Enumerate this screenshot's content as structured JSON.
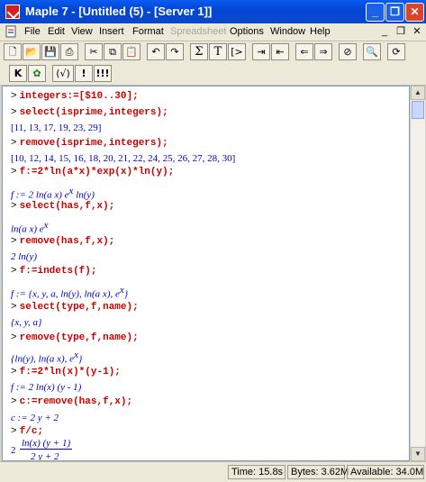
{
  "window": {
    "title": "Maple 7 - [Untitled (5) - [Server 1]]"
  },
  "menu": {
    "items": [
      {
        "label": "File"
      },
      {
        "label": "Edit"
      },
      {
        "label": "View"
      },
      {
        "label": "Insert"
      },
      {
        "label": "Format"
      },
      {
        "label": "Spreadsheet",
        "disabled": true
      },
      {
        "label": "Options"
      },
      {
        "label": "Window"
      },
      {
        "label": "Help"
      }
    ]
  },
  "toolbar2": {
    "k_label": "K",
    "paren_label": "(√)",
    "bang_label": "!",
    "bangs_label": "!!!"
  },
  "worksheet": {
    "lines": [
      {
        "type": "input",
        "prompt": ">",
        "text": "integers:=[$10..30];"
      },
      {
        "type": "input",
        "prompt": ">",
        "text": "select(isprime,integers);"
      },
      {
        "type": "output",
        "text": "[11, 13, 17, 19, 23, 29]"
      },
      {
        "type": "input",
        "prompt": ">",
        "text": "remove(isprime,integers);"
      },
      {
        "type": "output",
        "text": "[10, 12, 14, 15, 16, 18, 20, 21, 22, 24, 25, 26, 27, 28, 30]"
      },
      {
        "type": "input",
        "prompt": ">",
        "text": "f:=2*ln(a*x)*exp(x)*ln(y);"
      },
      {
        "type": "output",
        "text": "f := 2 ln(a x) e",
        "sup": "x",
        "tail": " ln(y)"
      },
      {
        "type": "input",
        "prompt": ">",
        "text": "select(has,f,x);"
      },
      {
        "type": "output",
        "text": "ln(a x) e",
        "sup": "x",
        "tail": ""
      },
      {
        "type": "input",
        "prompt": ">",
        "text": "remove(has,f,x);"
      },
      {
        "type": "output",
        "text": "2 ln(y)"
      },
      {
        "type": "input",
        "prompt": ">",
        "text": "f:=indets(f);"
      },
      {
        "type": "output",
        "text": "f := {x, y, a, ln(y), ln(a x), e",
        "sup": "x",
        "tail": "}"
      },
      {
        "type": "input",
        "prompt": ">",
        "text": "select(type,f,name);"
      },
      {
        "type": "output",
        "text": "{x, y, a}"
      },
      {
        "type": "input",
        "prompt": ">",
        "text": "remove(type,f,name);"
      },
      {
        "type": "output",
        "text": "{ln(y), ln(a x), e",
        "sup": "x",
        "tail": "}"
      },
      {
        "type": "input",
        "prompt": ">",
        "text": "f:=2*ln(x)*(y-1);"
      },
      {
        "type": "output",
        "text": "f := 2 ln(x) (y - 1)"
      },
      {
        "type": "input",
        "prompt": ">",
        "text": "c:=remove(has,f,x);"
      },
      {
        "type": "output",
        "text": "c := 2 y + 2"
      },
      {
        "type": "input",
        "prompt": ">",
        "text": "f/c;"
      },
      {
        "type": "fraction",
        "lead": "2",
        "num": "ln(x) (y + 1)",
        "den": "2 y + 2"
      }
    ]
  },
  "status": {
    "time": "Time: 15.8s",
    "bytes": "Bytes: 3.62M",
    "available": "Available: 34.0M"
  }
}
